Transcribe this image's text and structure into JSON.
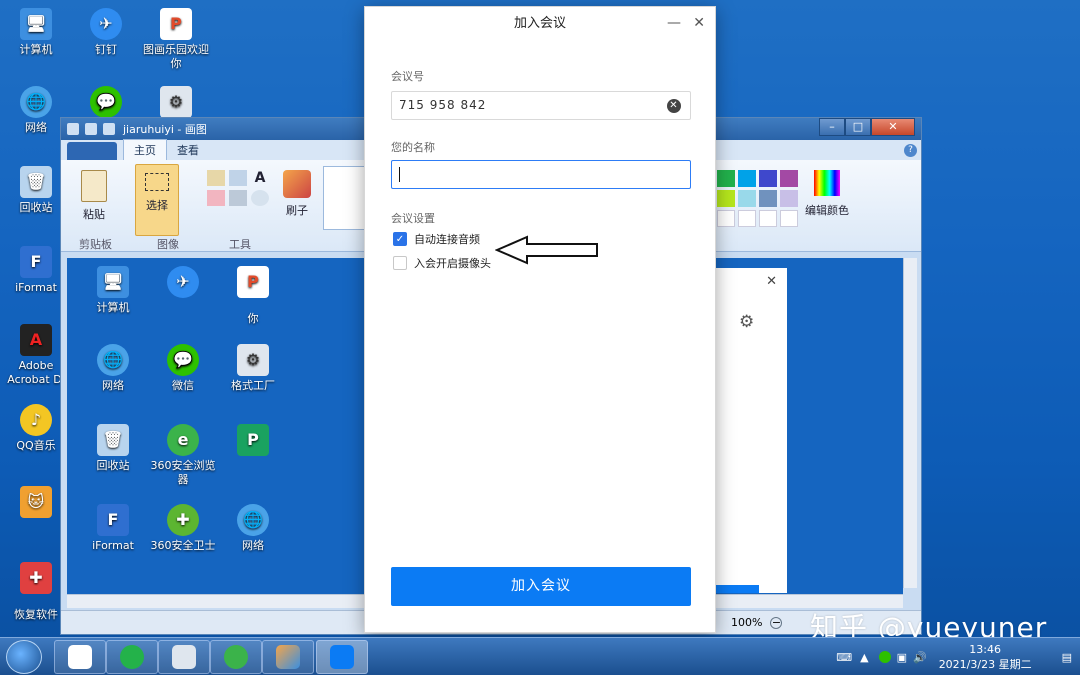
{
  "desktop": {
    "icons": [
      {
        "label": "计算机"
      },
      {
        "label": "钉钉"
      },
      {
        "label": "图画乐园欢迎你"
      },
      {
        "label": "网络"
      },
      {
        "label": "回收站"
      },
      {
        "label": "iFormat"
      },
      {
        "label": "Adobe Acrobat Di"
      },
      {
        "label": "QQ音乐"
      },
      {
        "label": "恢复软件"
      }
    ]
  },
  "paint": {
    "title": "jiaruhuiyi - 画图",
    "tabs": [
      "主页",
      "查看"
    ],
    "groups": {
      "clipboard": "剪贴板",
      "image": "图像",
      "tools": "工具",
      "paste": "粘贴",
      "select": "选择",
      "brush": "刷子",
      "edit_colors": "编辑颜色"
    },
    "canvas_icons": [
      {
        "label": "计算机"
      },
      {
        "label": "网络"
      },
      {
        "label": "微信"
      },
      {
        "label": "回收站"
      },
      {
        "label": "360安全浏览器"
      },
      {
        "label": "iFormat"
      },
      {
        "label": "360安全卫士"
      },
      {
        "label": "网络"
      },
      {
        "label": "你"
      },
      {
        "label": "格式工厂"
      }
    ],
    "zoom": "100%"
  },
  "dialog": {
    "title": "加入会议",
    "minimize": "—",
    "close": "✕",
    "meeting_id_label": "会议号",
    "meeting_id_value": "715 958 842",
    "name_label": "您的名称",
    "name_value": "",
    "settings_label": "会议设置",
    "auto_audio": {
      "label": "自动连接音频",
      "checked": true
    },
    "camera": {
      "label": "入会开启摄像头",
      "checked": false
    },
    "join_button": "加入会议"
  },
  "taskbar": {
    "time": "13:46",
    "date": "2021/3/23 星期二"
  },
  "watermark": "知乎 @yueyuner"
}
